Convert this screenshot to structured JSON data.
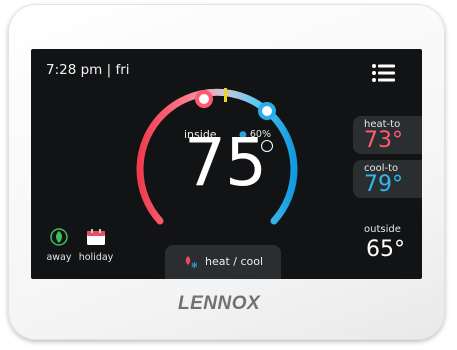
{
  "status": {
    "time": "7:28 pm | fri"
  },
  "indoor": {
    "label": "inside",
    "temperature": "75",
    "humidity": "60%"
  },
  "setpoints": {
    "heat": {
      "label": "heat-to",
      "value": "73°",
      "color": "#ff5a6e"
    },
    "cool": {
      "label": "cool-to",
      "value": "79°",
      "color": "#2fb8ee"
    }
  },
  "outdoor": {
    "label": "outside",
    "value": "65°"
  },
  "shortcuts": {
    "away_label": "away",
    "holiday_label": "holiday"
  },
  "mode": {
    "label": "heat / cool"
  },
  "brand": {
    "logo_text": "LENNOX"
  },
  "icons": [
    "menu-icon",
    "away-leaf-icon",
    "holiday-calendar-icon",
    "heat-cool-icon",
    "humidity-drop-icon"
  ]
}
